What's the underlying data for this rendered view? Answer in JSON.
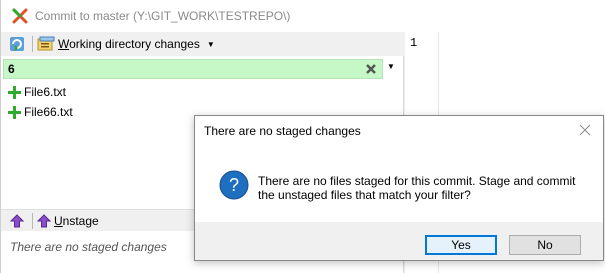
{
  "window": {
    "title": "Commit to master (Y:\\GIT_WORK\\TESTREPO\\)"
  },
  "toolbar": {
    "working_dir_label_prefix": "W",
    "working_dir_label_rest": "orking directory changes"
  },
  "filter": {
    "value": "6"
  },
  "unstaged_files": [
    {
      "name": "File6.txt",
      "icon": "plus-icon"
    },
    {
      "name": "File66.txt",
      "icon": "plus-icon"
    }
  ],
  "staged": {
    "unstage_prefix": "U",
    "unstage_rest": "nstage",
    "empty_text": "There are no staged changes"
  },
  "editor": {
    "line_number": "1"
  },
  "dialog": {
    "title": "There are no staged changes",
    "message": "There are no files staged for this commit. Stage and commit the unstaged files that match your filter?",
    "yes_label": "Yes",
    "no_label": "No"
  },
  "colors": {
    "filter_background": "#c6f7c6",
    "add_icon_green": "#2eaa2e",
    "question_blue": "#1f6fc0",
    "unstage_purple": "#8a4fc8",
    "default_button_border": "#0078d7"
  }
}
